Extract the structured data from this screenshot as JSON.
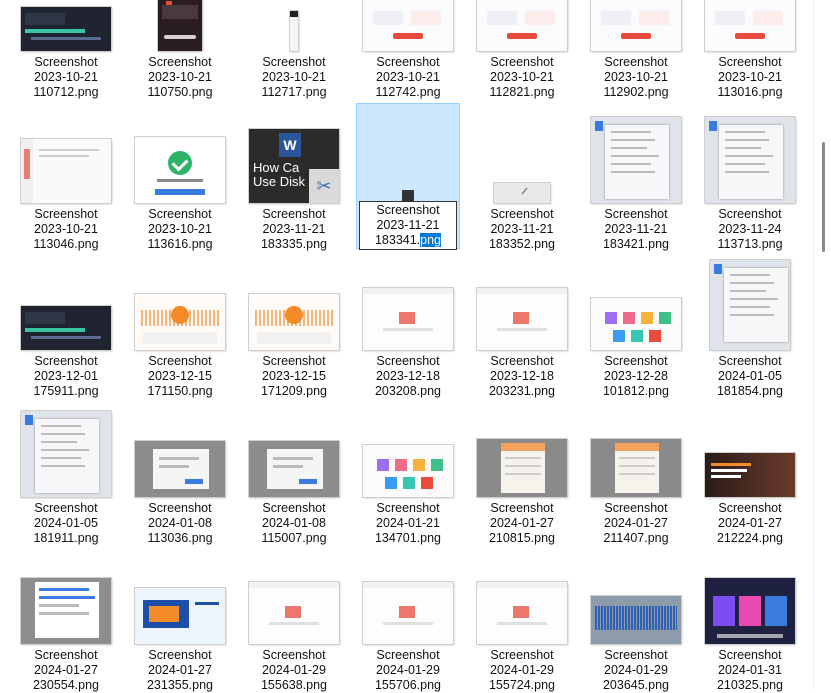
{
  "files": [
    {
      "name_line1": "Screenshot",
      "name_line2": "2023-10-21",
      "name_line3": "110712.png",
      "thumb": "dark-video-editor"
    },
    {
      "name_line1": "Screenshot",
      "name_line2": "2023-10-21",
      "name_line3": "110750.png",
      "thumb": "phone-dark"
    },
    {
      "name_line1": "Screenshot",
      "name_line2": "2023-10-21",
      "name_line3": "112717.png",
      "thumb": "thin-portrait"
    },
    {
      "name_line1": "Screenshot",
      "name_line2": "2023-10-21",
      "name_line3": "112742.png",
      "thumb": "light-app"
    },
    {
      "name_line1": "Screenshot",
      "name_line2": "2023-10-21",
      "name_line3": "112821.png",
      "thumb": "light-app"
    },
    {
      "name_line1": "Screenshot",
      "name_line2": "2023-10-21",
      "name_line3": "112902.png",
      "thumb": "light-app"
    },
    {
      "name_line1": "Screenshot",
      "name_line2": "2023-10-21",
      "name_line3": "113016.png",
      "thumb": "light-app"
    },
    {
      "name_line1": "Screenshot",
      "name_line2": "2023-10-21",
      "name_line3": "113046.png",
      "thumb": "light-list"
    },
    {
      "name_line1": "Screenshot",
      "name_line2": "2023-10-21",
      "name_line3": "113616.png",
      "thumb": "success-dialog"
    },
    {
      "name_line1": "Screenshot",
      "name_line2": "2023-11-21",
      "name_line3": "183335.png",
      "thumb": "word-dark",
      "overlay_text": "How Ca Use Disk"
    },
    {
      "rename": true,
      "rename_base": "Screenshot 2023-11-21 183341.",
      "rename_ext": "png",
      "thumb": "tiny-dark"
    },
    {
      "name_line1": "Screenshot",
      "name_line2": "2023-11-21",
      "name_line3": "183352.png",
      "thumb": "thin-bar"
    },
    {
      "name_line1": "Screenshot",
      "name_line2": "2023-11-21",
      "name_line3": "183421.png",
      "thumb": "context-menu"
    },
    {
      "name_line1": "Screenshot",
      "name_line2": "2023-11-24",
      "name_line3": "113713.png",
      "thumb": "context-menu"
    },
    {
      "name_line1": "Screenshot",
      "name_line2": "2023-12-01",
      "name_line3": "175911.png",
      "thumb": "dark-video-editor"
    },
    {
      "name_line1": "Screenshot",
      "name_line2": "2023-12-15",
      "name_line3": "171150.png",
      "thumb": "audio-orange"
    },
    {
      "name_line1": "Screenshot",
      "name_line2": "2023-12-15",
      "name_line3": "171209.png",
      "thumb": "audio-orange"
    },
    {
      "name_line1": "Screenshot",
      "name_line2": "2023-12-18",
      "name_line3": "203208.png",
      "thumb": "light-red-app"
    },
    {
      "name_line1": "Screenshot",
      "name_line2": "2023-12-18",
      "name_line3": "203231.png",
      "thumb": "light-red-app"
    },
    {
      "name_line1": "Screenshot",
      "name_line2": "2023-12-28",
      "name_line3": "101812.png",
      "thumb": "colorful-icons"
    },
    {
      "name_line1": "Screenshot",
      "name_line2": "2024-01-05",
      "name_line3": "181854.png",
      "thumb": "context-menu-tall"
    },
    {
      "name_line1": "Screenshot",
      "name_line2": "2024-01-05",
      "name_line3": "181911.png",
      "thumb": "context-menu"
    },
    {
      "name_line1": "Screenshot",
      "name_line2": "2024-01-08",
      "name_line3": "113036.png",
      "thumb": "gray-dialog"
    },
    {
      "name_line1": "Screenshot",
      "name_line2": "2024-01-08",
      "name_line3": "115007.png",
      "thumb": "gray-dialog"
    },
    {
      "name_line1": "Screenshot",
      "name_line2": "2024-01-21",
      "name_line3": "134701.png",
      "thumb": "colorful-icons"
    },
    {
      "name_line1": "Screenshot",
      "name_line2": "2024-01-27",
      "name_line3": "210815.png",
      "thumb": "gray-table-orange"
    },
    {
      "name_line1": "Screenshot",
      "name_line2": "2024-01-27",
      "name_line3": "211407.png",
      "thumb": "gray-table-orange"
    },
    {
      "name_line1": "Screenshot",
      "name_line2": "2024-01-27",
      "name_line3": "212224.png",
      "thumb": "dark-banner"
    },
    {
      "name_line1": "Screenshot",
      "name_line2": "2024-01-27",
      "name_line3": "230554.png",
      "thumb": "chat-window"
    },
    {
      "name_line1": "Screenshot",
      "name_line2": "2024-01-27",
      "name_line3": "231355.png",
      "thumb": "blue-web"
    },
    {
      "name_line1": "Screenshot",
      "name_line2": "2024-01-29",
      "name_line3": "155638.png",
      "thumb": "light-red-app"
    },
    {
      "name_line1": "Screenshot",
      "name_line2": "2024-01-29",
      "name_line3": "155706.png",
      "thumb": "light-red-app"
    },
    {
      "name_line1": "Screenshot",
      "name_line2": "2024-01-29",
      "name_line3": "155724.png",
      "thumb": "light-red-app"
    },
    {
      "name_line1": "Screenshot",
      "name_line2": "2024-01-29",
      "name_line3": "203645.png",
      "thumb": "blue-audio"
    },
    {
      "name_line1": "Screenshot",
      "name_line2": "2024-01-31",
      "name_line3": "210325.png",
      "thumb": "pricing-dark"
    }
  ],
  "colors": {
    "selection_bg": "#cce8ff",
    "selection_border": "#99d1ff",
    "rename_highlight": "#0078d7",
    "accent_red": "#e84a3c",
    "accent_orange": "#f28c28"
  },
  "icons": {
    "cut": "scissors-icon",
    "word": "word-app-icon"
  }
}
